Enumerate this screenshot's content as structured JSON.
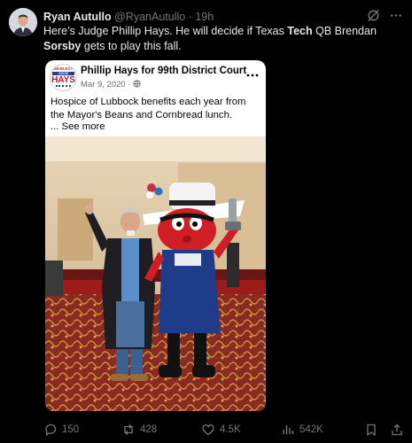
{
  "tweet": {
    "author_name": "Ryan Autullo",
    "handle": "@RyanAutullo",
    "separator": "·",
    "time": "19h",
    "text_parts": {
      "p1": "Here’s Judge Phillip Hays. He will decide if Texas ",
      "b1": "Tech",
      "p2": " QB Brendan ",
      "b2": "Sorsby",
      "p3": " gets to play this fall."
    }
  },
  "quoted_post": {
    "logo_text": {
      "top": "RE-ELECT",
      "band": "JUDGE PHILLIP",
      "main": "HAYS"
    },
    "page_name": "Phillip Hays for 99th District Court",
    "date": "Mar 9, 2020 ·",
    "text": "Hospice of Lubbock benefits each year from the Mayor's Beans and Cornbread lunch.",
    "see_more": "... See more"
  },
  "actions": {
    "replies": "150",
    "reposts": "428",
    "likes": "4.5K",
    "views": "542K"
  },
  "icons": {
    "header": [
      "grok-icon",
      "more-icon"
    ],
    "actions": [
      "reply-icon",
      "repost-icon",
      "like-icon",
      "views-icon",
      "bookmark-icon",
      "share-icon"
    ]
  },
  "colors": {
    "background": "#000000",
    "text": "#e7e9ea",
    "secondary": "#71767b"
  }
}
